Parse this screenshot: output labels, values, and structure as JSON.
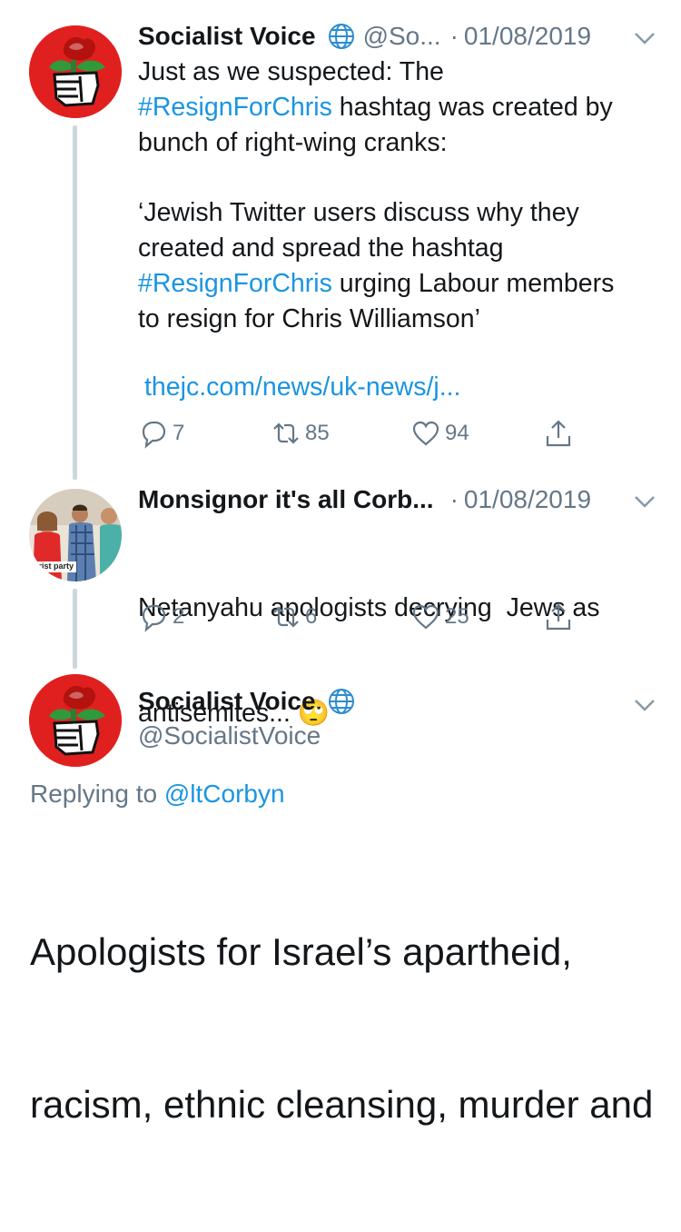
{
  "tweets": [
    {
      "name": "Socialist Voice",
      "handle": "@So...",
      "separator": "·",
      "date": "01/08/2019",
      "text_lines": [
        {
          "segments": [
            {
              "t": "Just as we suspected: The",
              "tag": false
            }
          ]
        },
        {
          "segments": [
            {
              "t": "#ResignForChris",
              "tag": true
            },
            {
              "t": " hashtag was created by",
              "tag": false
            }
          ]
        },
        {
          "segments": [
            {
              "t": "bunch of right-wing cranks:",
              "tag": false
            }
          ]
        },
        {
          "segments": [
            {
              "t": "",
              "tag": false
            }
          ]
        },
        {
          "segments": [
            {
              "t": "‘Jewish Twitter users discuss why they",
              "tag": false
            }
          ]
        },
        {
          "segments": [
            {
              "t": "created and spread the hashtag",
              "tag": false
            }
          ]
        },
        {
          "segments": [
            {
              "t": "#ResignForChris",
              "tag": true
            },
            {
              "t": " urging Labour members",
              "tag": false
            }
          ]
        },
        {
          "segments": [
            {
              "t": "to resign for Chris Williamson’",
              "tag": false
            }
          ]
        }
      ],
      "link": "thejc.com/news/uk-news/j...",
      "replies": "7",
      "retweets": "85",
      "likes": "94"
    },
    {
      "name": "Monsignor it's all Corb...",
      "separator": "·",
      "date": "01/08/2019",
      "text_line1": "Netanyahu apologists decrying  Jews as",
      "text_line2": "antisemites... ",
      "emoji": "🙄",
      "avatar_caption": "ntrist party",
      "replies": "2",
      "retweets": "6",
      "likes": "25"
    },
    {
      "name": "Socialist Voice",
      "handle": "@SocialistVoice",
      "replying_prefix": "Replying to ",
      "replying_handle": "@ltCorbyn",
      "big_text_line1": "Apologists for Israel’s apartheid,",
      "big_text_line2": "racism, ethnic cleansing, murder and"
    }
  ],
  "icons": {
    "globe": "globe-icon",
    "chevron": "chevron-down-icon",
    "reply": "reply-icon",
    "retweet": "retweet-icon",
    "like": "heart-icon",
    "share": "share-icon"
  },
  "colors": {
    "link": "#1b95e0",
    "secondary_text": "#657786",
    "thread_line": "#ccd6dd",
    "avatar_red": "#e0201f"
  }
}
